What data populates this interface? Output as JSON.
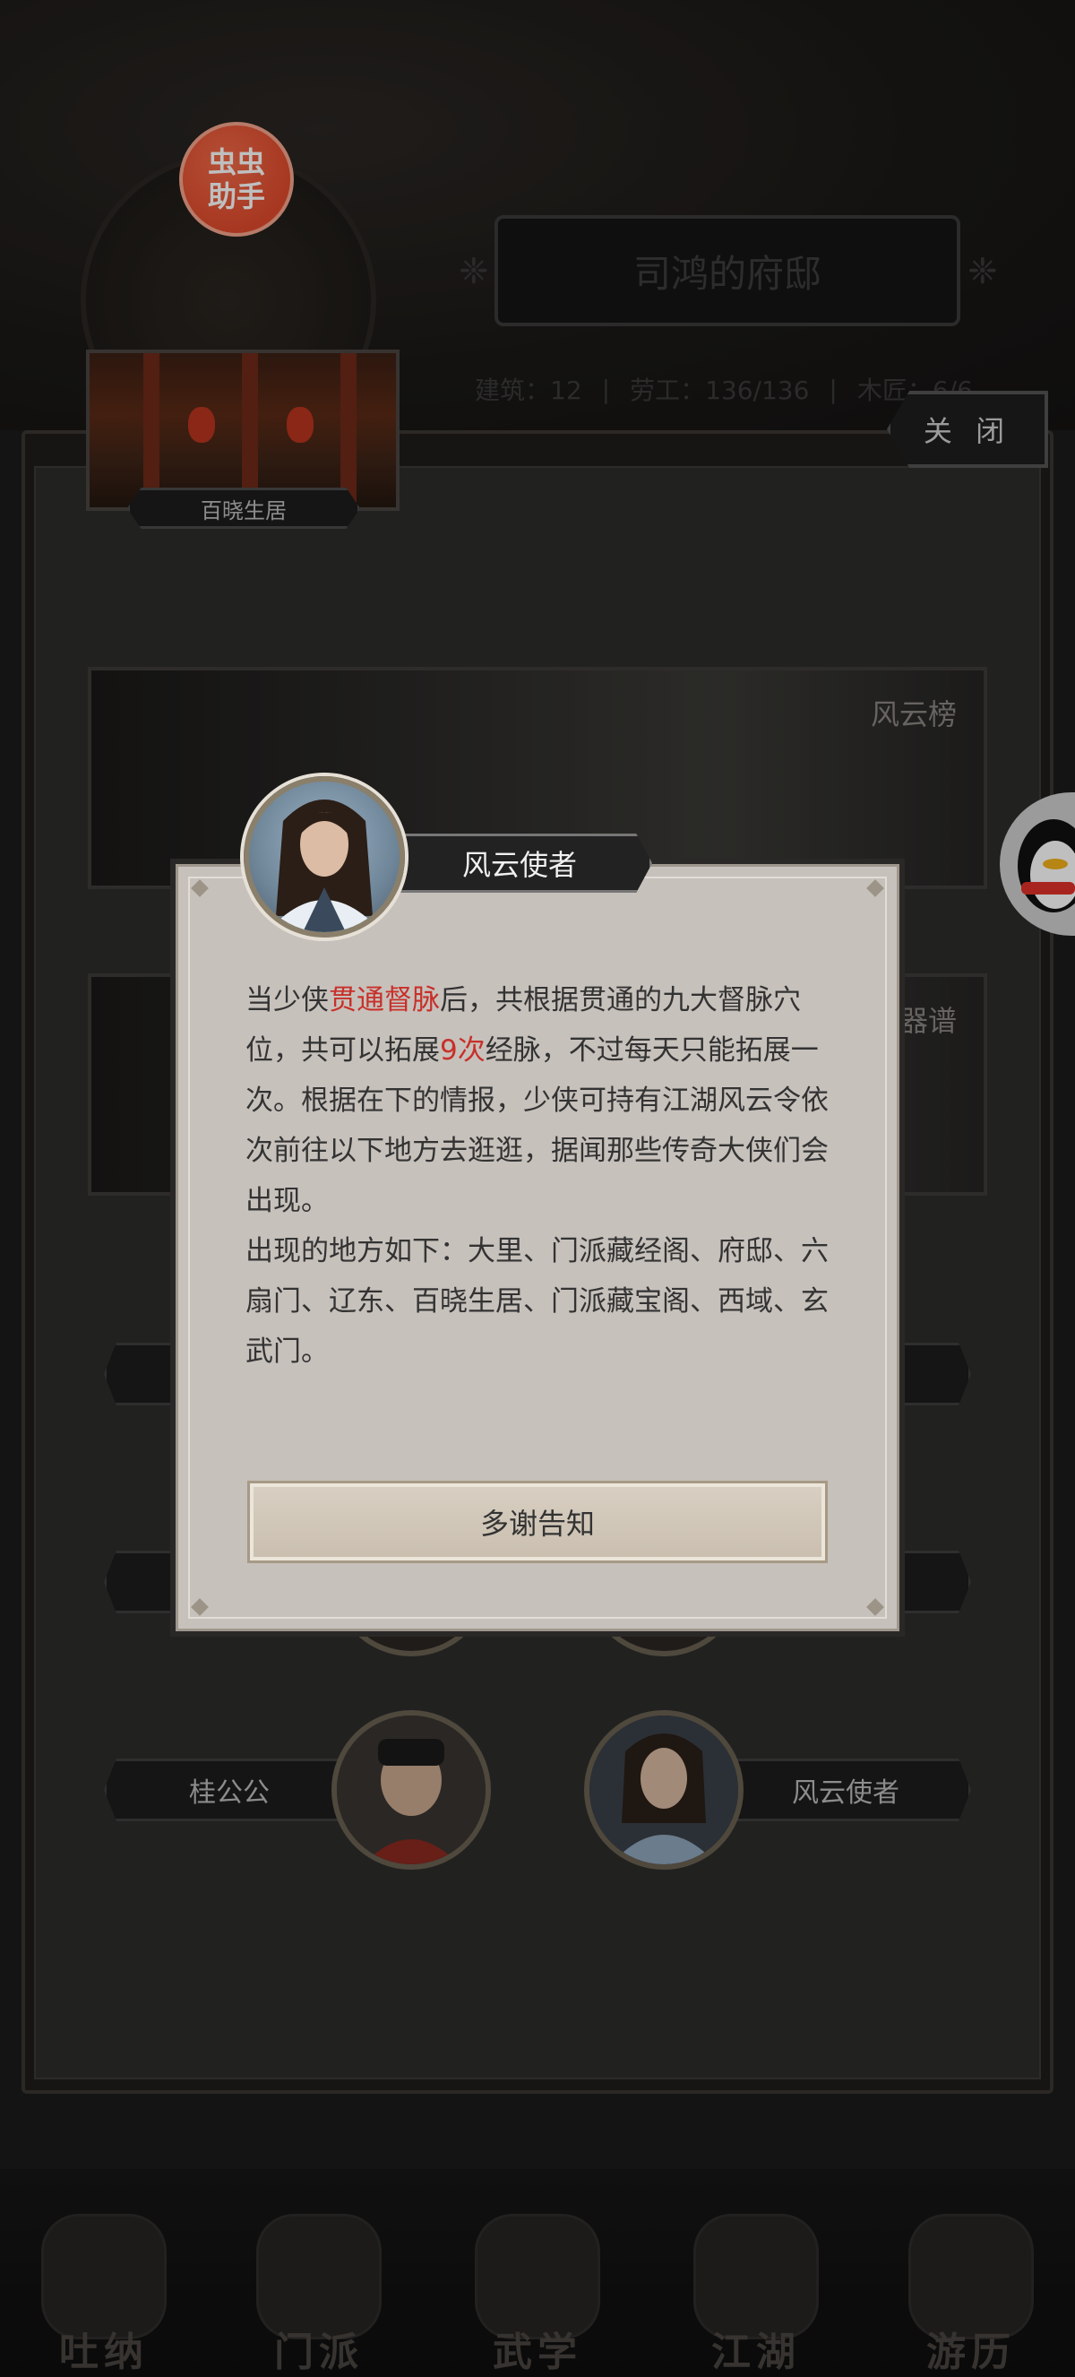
{
  "app": {
    "assist_badge_line1": "虫虫",
    "assist_badge_line2": "助手"
  },
  "header": {
    "title": "司鸿的府邸",
    "stats": [
      "建筑：12",
      "劳工：136/136",
      "木匠：6/6"
    ]
  },
  "close_label": "关 闭",
  "location_label": "百晓生居",
  "banners": {
    "ranking_label": "风云榜",
    "weapon_label": "器谱"
  },
  "npcs": {
    "left_label": "桂公公",
    "right_label": "风云使者"
  },
  "dialog": {
    "speaker": "风云使者",
    "segments": [
      {
        "text": "当少侠",
        "highlight": false
      },
      {
        "text": "贯通督脉",
        "highlight": true
      },
      {
        "text": "后，共根据贯通的九大督脉穴位，共可以拓展",
        "highlight": false
      },
      {
        "text": "9次",
        "highlight": true
      },
      {
        "text": "经脉，不过每天只能拓展一次。根据在下的情报，少侠可持有江湖风云令依次前往以下地方去逛逛，据闻那些传奇大侠们会出现。",
        "highlight": false
      }
    ],
    "paragraph2": "出现的地方如下：大里、门派藏经阁、府邸、六扇门、辽东、百晓生居、门派藏宝阁、西域、玄武门。",
    "confirm_label": "多谢告知"
  },
  "bottom_nav": [
    {
      "label": "吐纳",
      "icon": "breathing-icon"
    },
    {
      "label": "门派",
      "icon": "sect-icon"
    },
    {
      "label": "武学",
      "icon": "martial-arts-icon"
    },
    {
      "label": "江湖",
      "icon": "jianghu-icon"
    },
    {
      "label": "游历",
      "icon": "travel-icon"
    }
  ],
  "colors": {
    "highlight": "#c8302a",
    "dialog_bg": "#c7c1bc",
    "badge": "#e04a2c"
  }
}
